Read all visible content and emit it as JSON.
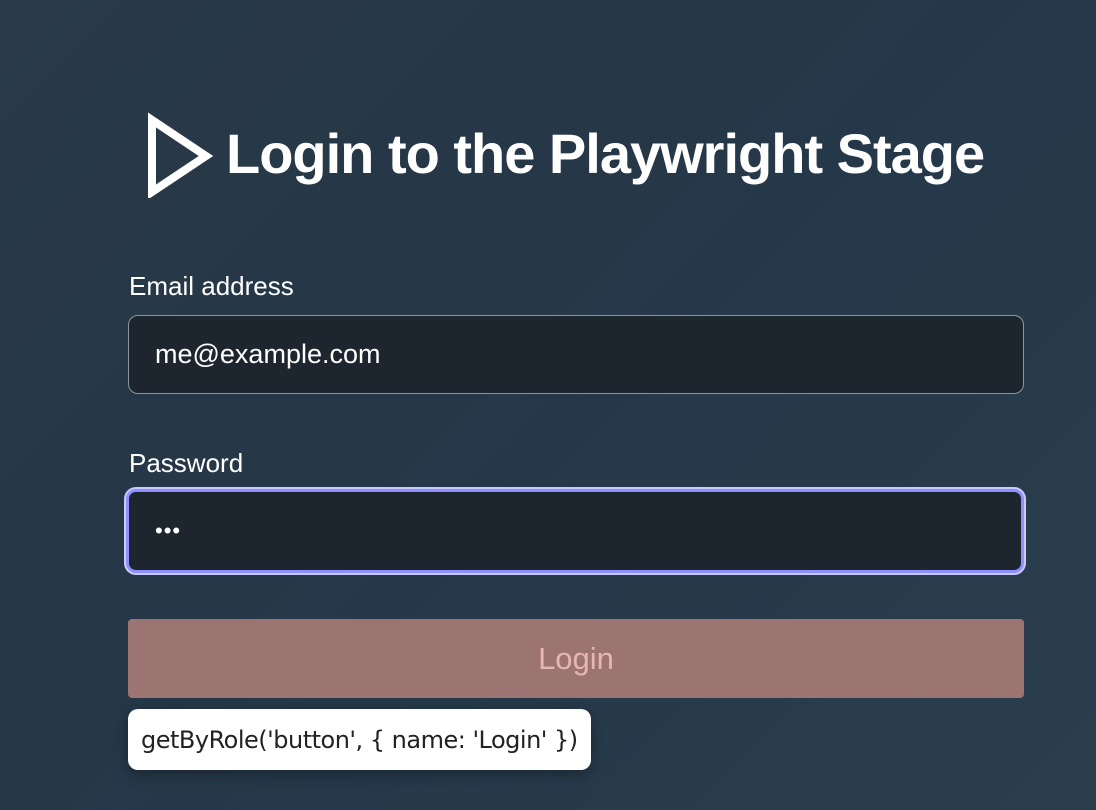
{
  "header": {
    "logo_icon": "play-triangle-icon",
    "title": "Login to the Playwright Stage"
  },
  "form": {
    "email": {
      "label": "Email address",
      "value": "me@example.com"
    },
    "password": {
      "label": "Password",
      "value": "•••"
    },
    "login_button": {
      "label": "Login",
      "state": "disabled"
    }
  },
  "tooltip": {
    "text": "getByRole('button', { name: 'Login' })"
  },
  "colors": {
    "focus_ring": "#8f90ff",
    "button_bg": "#9c7472",
    "button_text": "#e7b6b2",
    "input_bg": "#1d262f"
  }
}
